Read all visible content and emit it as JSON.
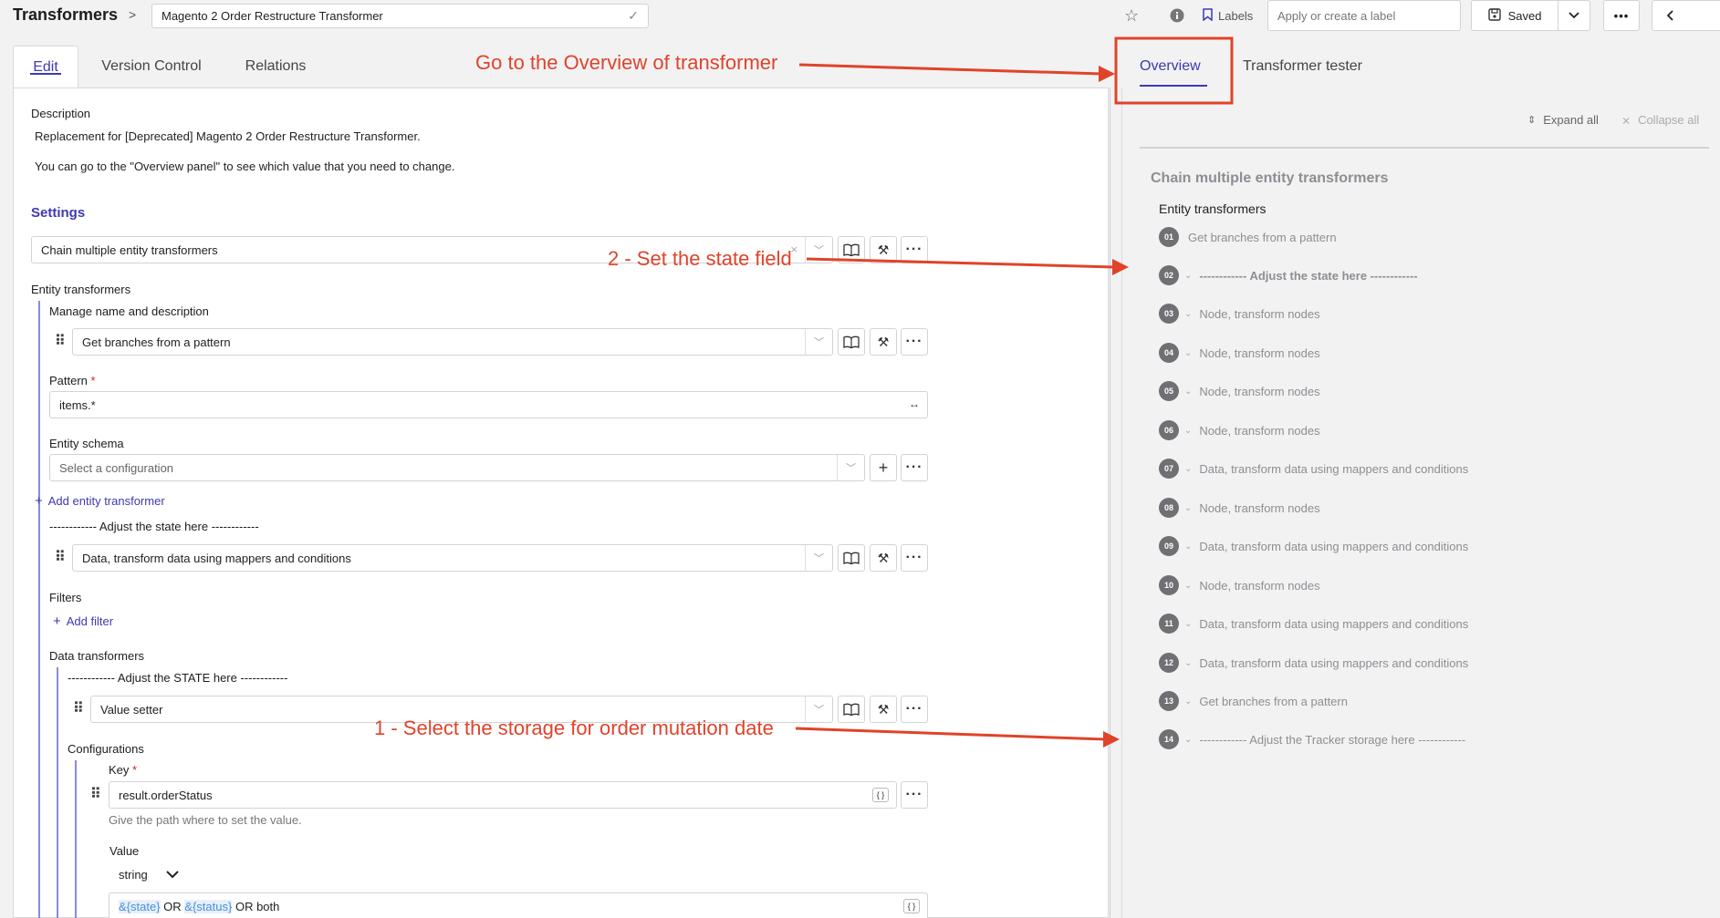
{
  "topbar": {
    "title": "Transformers",
    "breadcrumb_sep": ">",
    "name_value": "Magento 2 Order Restructure Transformer",
    "labels_label": "Labels",
    "label_placeholder": "Apply or create a label",
    "saved_label": "Saved"
  },
  "left_tabs": [
    "Edit",
    "Version Control",
    "Relations"
  ],
  "right_tabs": [
    "Overview",
    "Transformer tester"
  ],
  "edit": {
    "description_label": "Description",
    "description_line1": "Replacement for [Deprecated] Magento 2 Order Restructure Transformer.",
    "description_line2": "You can go to the \"Overview panel\" to see which value that you need to change.",
    "settings_label": "Settings",
    "main_select": "Chain multiple entity transformers",
    "entity_transformers_label": "Entity transformers",
    "manage_name_label": "Manage name and description",
    "et1_select": "Get branches from a pattern",
    "pattern_label": "Pattern",
    "pattern_value": "items.*",
    "entity_schema_label": "Entity schema",
    "entity_schema_placeholder": "Select a configuration",
    "add_entity_transformer": "Add entity transformer",
    "et2_name": "------------ Adjust the state here ------------",
    "et2_select": "Data, transform data using mappers and conditions",
    "filters_label": "Filters",
    "add_filter": "Add filter",
    "data_transformers_label": "Data transformers",
    "dt_name": "------------ Adjust the STATE here ------------",
    "dt_select": "Value setter",
    "configurations_label": "Configurations",
    "key_label": "Key",
    "key_value": "result.orderStatus",
    "key_hint": "Give the path where to set the value.",
    "value_label": "Value",
    "value_type": "string",
    "value_var1": "&{state}",
    "value_or1": "OR",
    "value_var2": "&{status}",
    "value_or2": "OR both",
    "required_mark": "*"
  },
  "overview": {
    "expand_all": "Expand all",
    "collapse_all": "Collapse all",
    "chain_title": "Chain multiple entity transformers",
    "entity_transformers_label": "Entity transformers",
    "steps": [
      {
        "num": "01",
        "label": "Get branches from a pattern",
        "chevron": false
      },
      {
        "num": "02",
        "label": "------------ Adjust the state here ------------",
        "chevron": true
      },
      {
        "num": "03",
        "label": "Node, transform nodes",
        "chevron": true
      },
      {
        "num": "04",
        "label": "Node, transform nodes",
        "chevron": true
      },
      {
        "num": "05",
        "label": "Node, transform nodes",
        "chevron": true
      },
      {
        "num": "06",
        "label": "Node, transform nodes",
        "chevron": true
      },
      {
        "num": "07",
        "label": "Data, transform data using mappers and conditions",
        "chevron": true
      },
      {
        "num": "08",
        "label": "Node, transform nodes",
        "chevron": true
      },
      {
        "num": "09",
        "label": "Data, transform data using mappers and conditions",
        "chevron": true
      },
      {
        "num": "10",
        "label": "Node, transform nodes",
        "chevron": true
      },
      {
        "num": "11",
        "label": "Data, transform data using mappers and conditions",
        "chevron": true
      },
      {
        "num": "12",
        "label": "Data, transform data using mappers and conditions",
        "chevron": true
      },
      {
        "num": "13",
        "label": "Get branches from a pattern",
        "chevron": true
      },
      {
        "num": "14",
        "label": "------------ Adjust the Tracker storage here ------------",
        "chevron": true
      }
    ]
  },
  "annotations": {
    "overview_hint": "Go to the Overview of transformer",
    "state_hint": "2 - Set the state field",
    "storage_hint": "1 - Select the storage for order mutation date"
  },
  "colors": {
    "accent": "#3d3ab0",
    "annotation": "#e0432a"
  }
}
